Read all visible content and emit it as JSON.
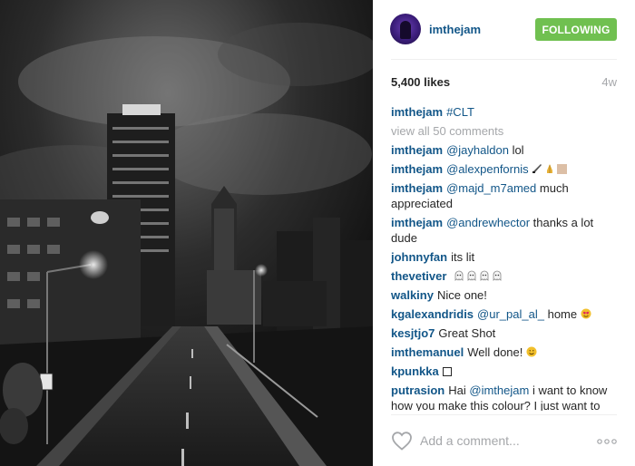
{
  "post": {
    "username": "imthejam",
    "follow_label": "FOLLOWING",
    "likes": "5,400 likes",
    "age": "4w",
    "caption_user": "imthejam",
    "caption_text": "#CLT",
    "view_all": "view all 50 comments",
    "comment_placeholder": "Add a comment...",
    "accent_color": "#125688",
    "follow_color": "#70c050"
  },
  "comments": [
    {
      "user": "imthejam",
      "mention": "@jayhaldon",
      "text": "lol",
      "emoji": []
    },
    {
      "user": "imthejam",
      "mention": "@alexpenfornis",
      "text": "",
      "emoji": [
        "knife-emoji",
        "praying-hands-emoji",
        "tan-square-emoji"
      ]
    },
    {
      "user": "imthejam",
      "mention": "@majd_m7amed",
      "text": "much appreciated",
      "emoji": []
    },
    {
      "user": "imthejam",
      "mention": "@andrewhector",
      "text": "thanks a lot dude",
      "emoji": []
    },
    {
      "user": "johnnyfan",
      "mention": "",
      "text": "its lit",
      "emoji": []
    },
    {
      "user": "thevetiver",
      "mention": "",
      "text": "",
      "emoji": [
        "ghost-emoji",
        "ghost-emoji",
        "ghost-emoji",
        "ghost-emoji"
      ]
    },
    {
      "user": "walkiny",
      "mention": "",
      "text": "Nice one!",
      "emoji": []
    },
    {
      "user": "kgalexandridis",
      "mention": "@ur_pal_al_",
      "text": "home",
      "emoji": [
        "heart-eyes-emoji"
      ]
    },
    {
      "user": "kesjtjo7",
      "mention": "",
      "text": "Great Shot",
      "emoji": []
    },
    {
      "user": "imthemanuel",
      "mention": "",
      "text": "Well done!",
      "emoji": [
        "smiling-face-emoji"
      ]
    },
    {
      "user": "kpunkka",
      "mention": "",
      "text": "",
      "emoji": [
        "empty-box-emoji"
      ]
    },
    {
      "user": "putrasion",
      "mention": "@imthejam",
      "text": "i want to know how you make this colour? I just want to know hiw to make it",
      "prefix": "Hai",
      "emoji": []
    }
  ]
}
